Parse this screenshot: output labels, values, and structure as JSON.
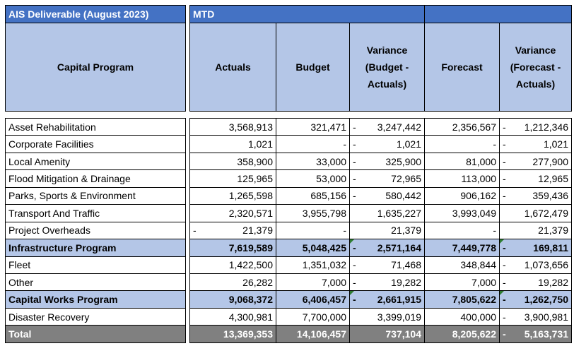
{
  "header": {
    "title": "AIS Deliverable   (August 2023)",
    "group": "MTD",
    "columns": {
      "program": "Capital Program",
      "actuals": "Actuals",
      "budget": "Budget",
      "variance_budget": "Variance (Budget - Actuals)",
      "forecast": "Forecast",
      "variance_forecast": "Variance (Forecast - Actuals)"
    }
  },
  "rows": [
    {
      "name": "Asset Rehabilitation",
      "actuals": "3,568,913",
      "budget": "321,471",
      "var_b": "3,247,442",
      "var_b_neg": true,
      "forecast": "2,356,567",
      "var_f": "1,212,346",
      "var_f_neg": true
    },
    {
      "name": "Corporate Facilities",
      "actuals": "1,021",
      "budget": "-",
      "var_b": "1,021",
      "var_b_neg": true,
      "forecast": "-",
      "var_f": "1,021",
      "var_f_neg": true
    },
    {
      "name": "Local Amenity",
      "actuals": "358,900",
      "budget": "33,000",
      "var_b": "325,900",
      "var_b_neg": true,
      "forecast": "81,000",
      "var_f": "277,900",
      "var_f_neg": true
    },
    {
      "name": "Flood Mitigation & Drainage",
      "actuals": "125,965",
      "budget": "53,000",
      "var_b": "72,965",
      "var_b_neg": true,
      "forecast": "113,000",
      "var_f": "12,965",
      "var_f_neg": true
    },
    {
      "name": "Parks, Sports & Environment",
      "actuals": "1,265,598",
      "budget": "685,156",
      "var_b": "580,442",
      "var_b_neg": true,
      "forecast": "906,162",
      "var_f": "359,436",
      "var_f_neg": true
    },
    {
      "name": "Transport And Traffic",
      "actuals": "2,320,571",
      "budget": "3,955,798",
      "var_b": "1,635,227",
      "var_b_neg": false,
      "forecast": "3,993,049",
      "var_f": "1,672,479",
      "var_f_neg": false
    },
    {
      "name": "Project Overheads",
      "actuals": "21,379",
      "actuals_neg": true,
      "budget": "-",
      "var_b": "21,379",
      "var_b_neg": false,
      "forecast": "-",
      "var_f": "21,379",
      "var_f_neg": false
    },
    {
      "name": "Infrastructure Program",
      "actuals": "7,619,589",
      "budget": "5,048,425",
      "var_b": "2,571,164",
      "var_b_neg": true,
      "forecast": "7,449,778",
      "var_f": "169,811",
      "var_f_neg": true,
      "style": "sub"
    },
    {
      "name": "Fleet",
      "actuals": "1,422,500",
      "budget": "1,351,032",
      "var_b": "71,468",
      "var_b_neg": true,
      "forecast": "348,844",
      "var_f": "1,073,656",
      "var_f_neg": true
    },
    {
      "name": "Other",
      "actuals": "26,282",
      "budget": "7,000",
      "var_b": "19,282",
      "var_b_neg": true,
      "forecast": "7,000",
      "var_f": "19,282",
      "var_f_neg": true
    },
    {
      "name": "Capital Works Program",
      "actuals": "9,068,372",
      "budget": "6,406,457",
      "var_b": "2,661,915",
      "var_b_neg": true,
      "forecast": "7,805,622",
      "var_f": "1,262,750",
      "var_f_neg": true,
      "style": "sub"
    },
    {
      "name": "Disaster Recovery",
      "actuals": "4,300,981",
      "budget": "7,700,000",
      "var_b": "3,399,019",
      "var_b_neg": false,
      "forecast": "400,000",
      "var_f": "3,900,981",
      "var_f_neg": true
    },
    {
      "name": "Total",
      "actuals": "13,369,353",
      "budget": "14,106,457",
      "var_b": "737,104",
      "var_b_neg": false,
      "forecast": "8,205,622",
      "var_f": "5,163,731",
      "var_f_neg": true,
      "style": "tot"
    }
  ]
}
